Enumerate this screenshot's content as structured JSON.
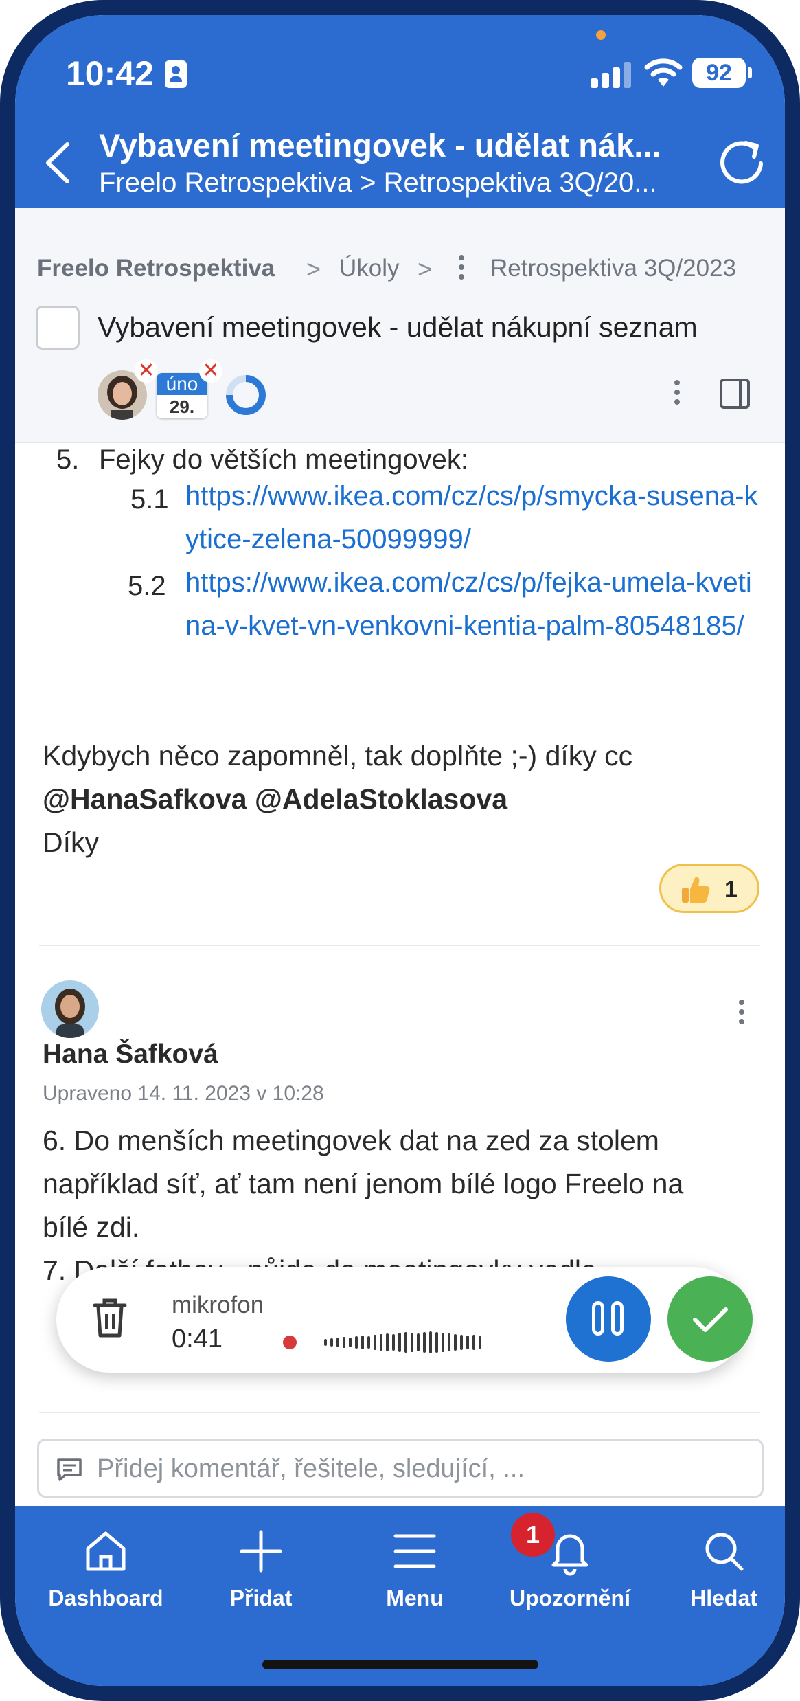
{
  "status_bar": {
    "time": "10:42",
    "battery": "92"
  },
  "header": {
    "title": "Vybavení meetingovek - udělat nák...",
    "subtitle": "Freelo Retrospektiva > Retrospektiva 3Q/20..."
  },
  "breadcrumb": {
    "project": "Freelo Retrospektiva",
    "section": "Úkoly",
    "list": "Retrospektiva 3Q/2023",
    "separator": ">"
  },
  "task": {
    "title": "Vybavení meetingovek - udělat nákupní seznam",
    "due_month": "úno",
    "due_day": "29.",
    "remove_mark": "✕"
  },
  "description": {
    "item_num": "5.",
    "item_text": "Fejky do větších meetingovek:",
    "links": [
      {
        "num": "5.1",
        "url": "https://www.ikea.com/cz/cs/p/smycka-susena-kytice-zelena-50099999/"
      },
      {
        "num": "5.2",
        "url": "https://www.ikea.com/cz/cs/p/fejka-umela-kvetina-v-kvet-vn-venkovni-kentia-palm-80548185/"
      }
    ],
    "closing": "Kdybych něco zapomněl, tak doplňte ;-) díky cc",
    "mentions": "@HanaSafkova @AdelaStoklasova",
    "thanks": "Díky",
    "reaction_count": "1"
  },
  "comment": {
    "author": "Hana Šafková",
    "meta": "Upraveno 14. 11. 2023 v 10:28",
    "lines": [
      "6. Do menších meetingovek dat na zed za stolem",
      "například síť, ať tam není jenom bílé logo Freelo na",
      "bílé zdi.",
      "7. Další fatboy - půjde do meetingovky vedle"
    ]
  },
  "recorder": {
    "label": "mikrofon",
    "time": "0:41"
  },
  "comment_input": {
    "placeholder": "Přidej komentář, řešitele, sledující, ..."
  },
  "nav": {
    "items": [
      {
        "label": "Dashboard",
        "icon": "home-icon"
      },
      {
        "label": "Přidat",
        "icon": "plus-icon"
      },
      {
        "label": "Menu",
        "icon": "menu-icon"
      },
      {
        "label": "Upozornění",
        "icon": "bell-icon"
      },
      {
        "label": "Hledat",
        "icon": "search-icon"
      }
    ],
    "notification_count": "1"
  },
  "colors": {
    "brand_blue": "#2c6bd0",
    "link": "#1a6fd1",
    "confirm_green": "#4bb155",
    "badge_red": "#d7232d"
  }
}
